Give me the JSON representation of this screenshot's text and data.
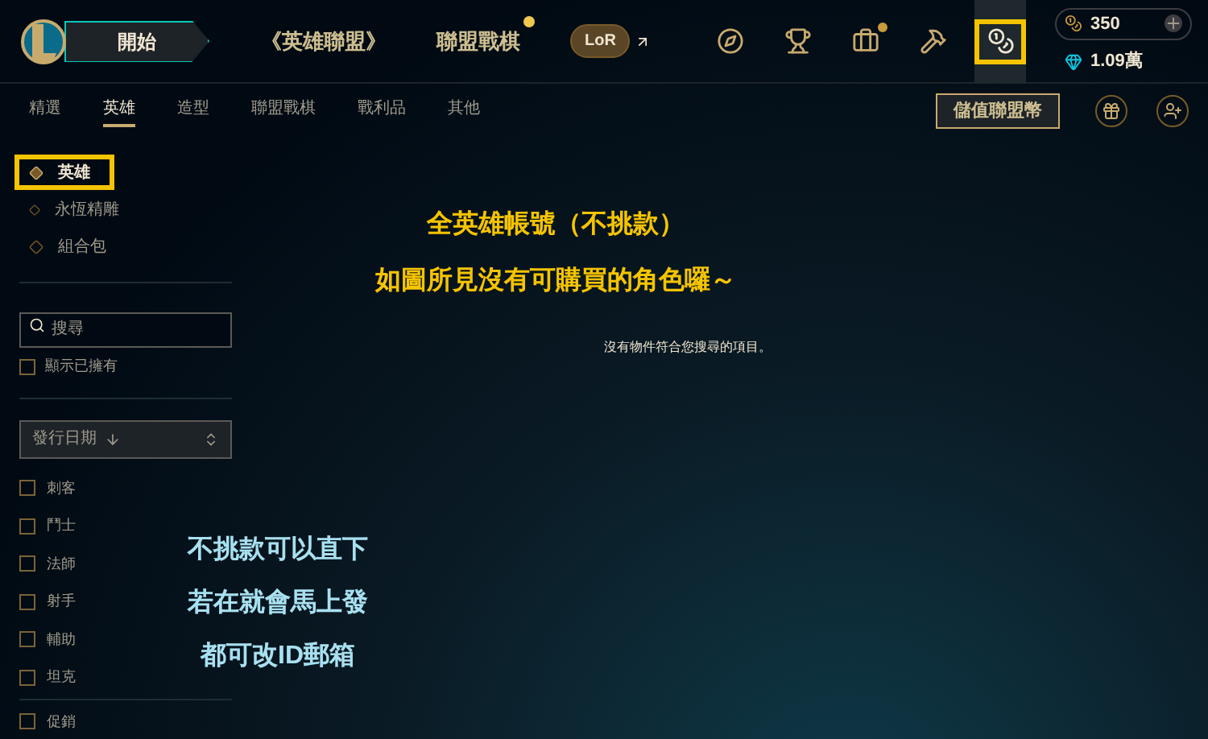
{
  "top_bar": {
    "play_button": "開始",
    "nav_links": [
      {
        "label": "《英雄聯盟》",
        "notification": false
      },
      {
        "label": "聯盟戰棋",
        "notification": true
      }
    ],
    "lor_badge": "LoR",
    "icons": [
      {
        "kind": "compass",
        "notification": false,
        "highlighted": false,
        "selected": false
      },
      {
        "kind": "trophy",
        "notification": false,
        "highlighted": false,
        "selected": false
      },
      {
        "kind": "bag",
        "notification": true,
        "highlighted": false,
        "selected": false
      },
      {
        "kind": "crafting",
        "notification": false,
        "highlighted": false,
        "selected": false
      },
      {
        "kind": "store",
        "notification": false,
        "highlighted": true,
        "selected": true
      }
    ],
    "currency": [
      {
        "kind": "rp",
        "amount": "350"
      },
      {
        "kind": "essence",
        "amount": "1.09萬"
      }
    ]
  },
  "store_tabs": [
    {
      "label": "精選",
      "selected": false
    },
    {
      "label": "英雄",
      "selected": true
    },
    {
      "label": "造型",
      "selected": false
    },
    {
      "label": "聯盟戰棋",
      "selected": false
    },
    {
      "label": "戰利品",
      "selected": false
    },
    {
      "label": "其他",
      "selected": false
    }
  ],
  "buy_rp_button": "儲值聯盟幣",
  "sidebar": {
    "categories": [
      {
        "label": "英雄",
        "selected": true,
        "highlighted": true
      },
      {
        "label": "永恆精雕",
        "selected": false,
        "highlighted": false
      },
      {
        "label": "組合包",
        "selected": false,
        "highlighted": false
      }
    ],
    "search": {
      "placeholder": "搜尋"
    },
    "show_owned": {
      "label": "顯示已擁有",
      "checked": false
    },
    "sort": {
      "value": "發行日期"
    },
    "roles": [
      {
        "label": "刺客",
        "checked": false
      },
      {
        "label": "鬥士",
        "checked": false
      },
      {
        "label": "法師",
        "checked": false
      },
      {
        "label": "射手",
        "checked": false
      },
      {
        "label": "輔助",
        "checked": false
      },
      {
        "label": "坦克",
        "checked": false
      }
    ],
    "sale": {
      "label": "促銷",
      "checked": false
    }
  },
  "empty_message": "沒有物件符合您搜尋的項目。",
  "caption_top": [
    "全英雄帳號（不挑款）",
    "如圖所見沒有可購買的角色囉～"
  ],
  "caption_bottom": [
    "不挑款可以直下",
    "若在就會馬上發",
    "都可改ID郵箱"
  ]
}
